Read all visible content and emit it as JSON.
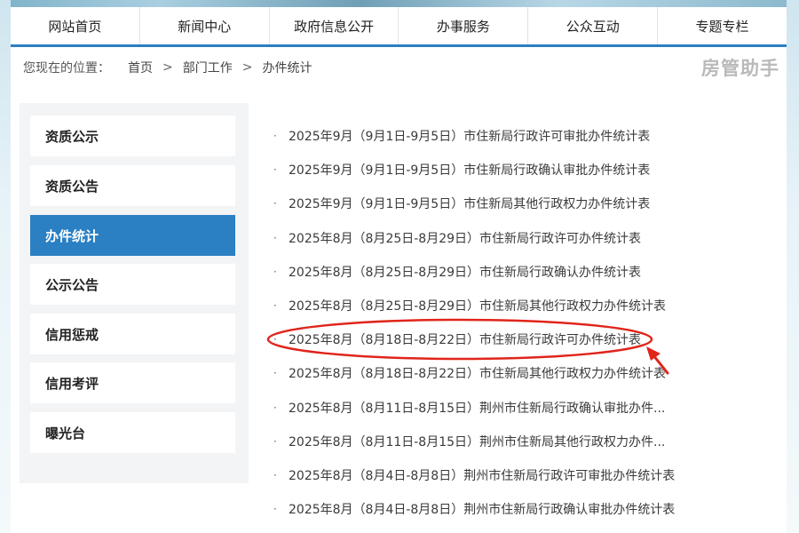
{
  "nav": {
    "items": [
      "网站首页",
      "新闻中心",
      "政府信息公开",
      "办事服务",
      "公众互动",
      "专题专栏"
    ]
  },
  "breadcrumb": {
    "label": "您现在的位置：",
    "items": [
      "首页",
      "部门工作",
      "办件统计"
    ],
    "separator": ">"
  },
  "brand": {
    "text": "房管助手"
  },
  "sidebar": {
    "items": [
      {
        "label": "资质公示",
        "active": false
      },
      {
        "label": "资质公告",
        "active": false
      },
      {
        "label": "办件统计",
        "active": true
      },
      {
        "label": "公示公告",
        "active": false
      },
      {
        "label": "信用惩戒",
        "active": false
      },
      {
        "label": "信用考评",
        "active": false
      },
      {
        "label": "曝光台",
        "active": false
      }
    ]
  },
  "list": {
    "bullet": "·",
    "items": [
      "2025年9月（9月1日-9月5日）市住新局行政许可审批办件统计表",
      "2025年9月（9月1日-9月5日）市住新局行政确认审批办件统计表",
      "2025年9月（9月1日-9月5日）市住新局其他行政权力办件统计表",
      "2025年8月（8月25日-8月29日）市住新局行政许可办件统计表",
      "2025年8月（8月25日-8月29日）市住新局行政确认办件统计表",
      "2025年8月（8月25日-8月29日）市住新局其他行政权力办件统计表",
      "2025年8月（8月18日-8月22日）市住新局行政许可办件统计表",
      "2025年8月（8月18日-8月22日）市住新局其他行政权力办件统计表",
      "2025年8月（8月11日-8月15日）荆州市住新局行政确认审批办件...",
      "2025年8月（8月11日-8月15日）荆州市住新局其他行政权力办件...",
      "2025年8月（8月4日-8月8日）荆州市住新局行政许可审批办件统计表",
      "2025年8月（8月4日-8月8日）荆州市住新局行政确认审批办件统计表"
    ],
    "highlighted_index": 6
  },
  "colors": {
    "accent": "#2b7fc3",
    "annotation": "#e0251b",
    "brand_text": "#b9b9b9"
  }
}
